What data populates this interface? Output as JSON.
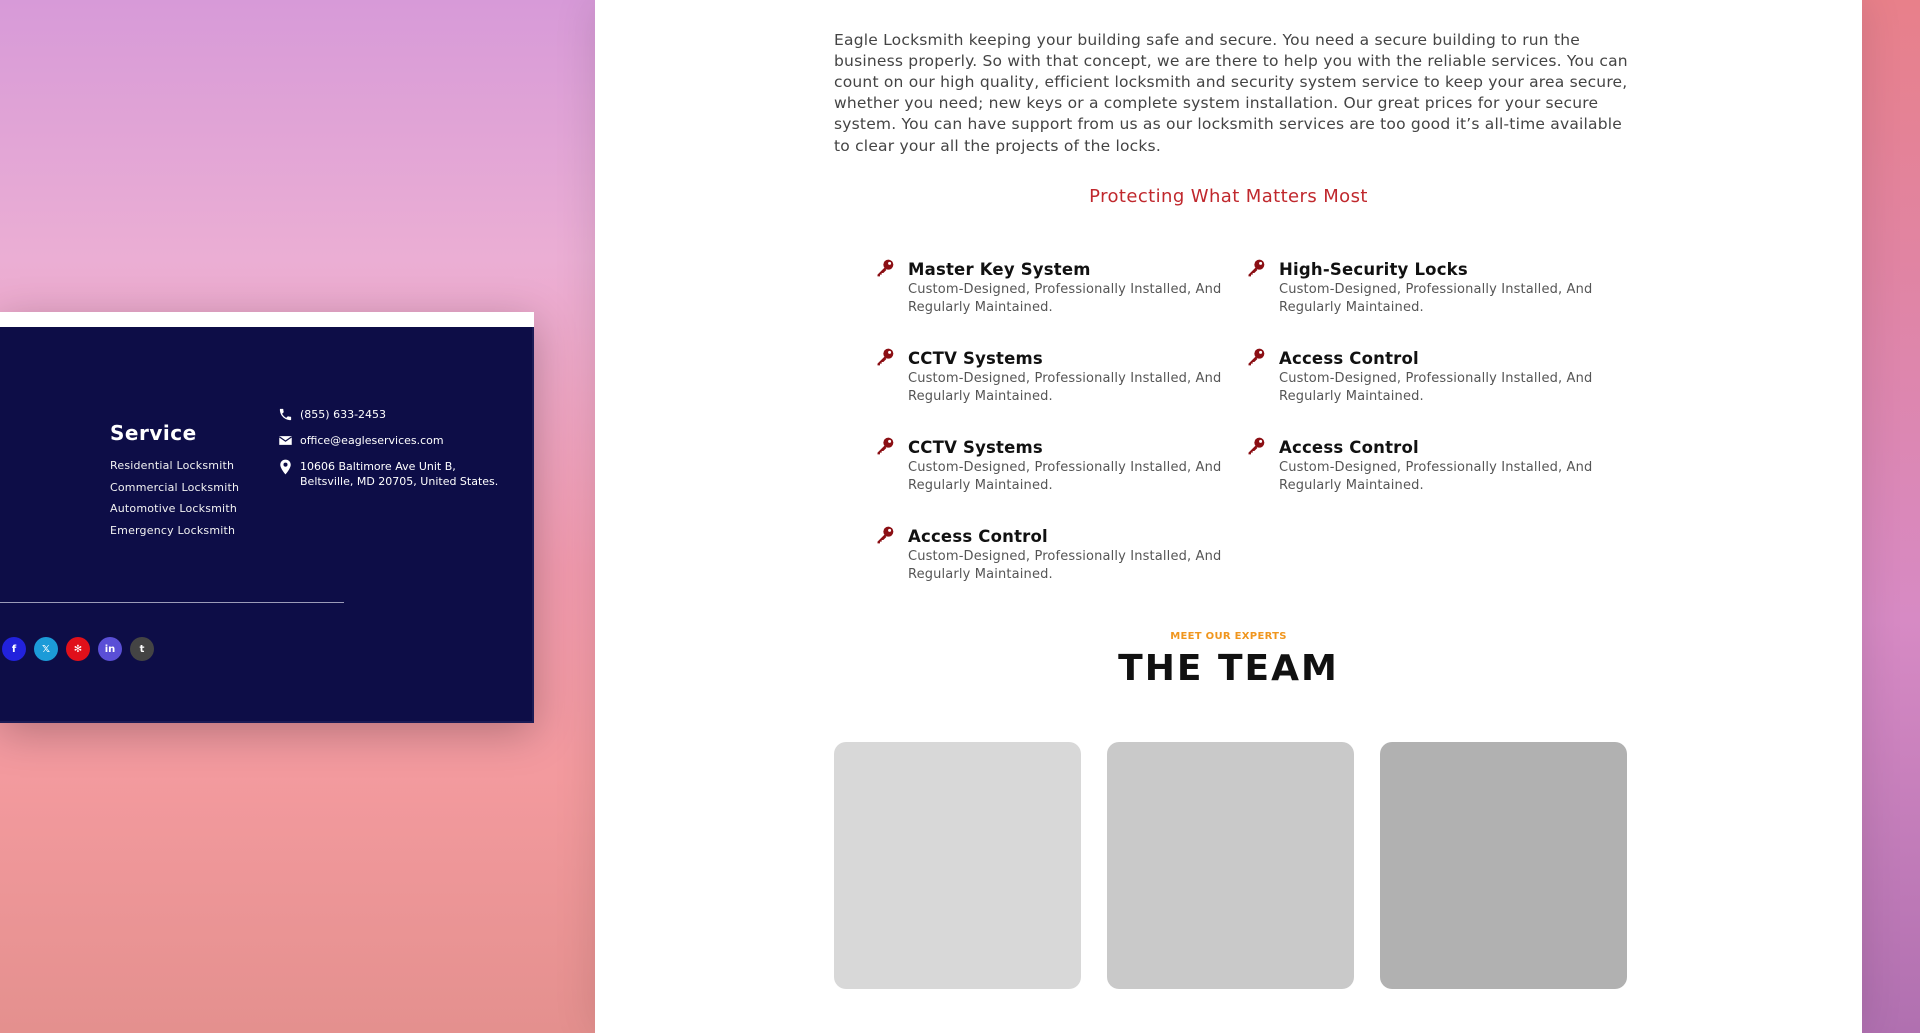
{
  "content": {
    "intro": "Eagle Locksmith keeping your building safe and secure. You need a secure building to run the business properly. So with that concept, we are there to help you with the reliable services. You can count on our high quality, efficient locksmith and security system service to keep your area secure, whether you need; new keys or a complete system installation. Our great prices for your secure system. You can have support from us as our locksmith services are too good it’s all-time available to clear your all the projects of the locks.",
    "section_title": "Protecting What Matters Most",
    "features": [
      {
        "title": "Master Key System",
        "desc": "Custom-Designed, Professionally Installed, And Regularly Maintained.",
        "icon": "key-icon"
      },
      {
        "title": "High-Security Locks",
        "desc": "Custom-Designed, Professionally Installed, And Regularly Maintained.",
        "icon": "key-icon"
      },
      {
        "title": "CCTV Systems",
        "desc": "Custom-Designed, Professionally Installed, And Regularly Maintained.",
        "icon": "key-icon"
      },
      {
        "title": "Access Control",
        "desc": "Custom-Designed, Professionally Installed, And Regularly Maintained.",
        "icon": "key-icon"
      },
      {
        "title": "CCTV Systems",
        "desc": "Custom-Designed, Professionally Installed, And Regularly Maintained.",
        "icon": "key-icon"
      },
      {
        "title": "Access Control",
        "desc": "Custom-Designed, Professionally Installed, And Regularly Maintained.",
        "icon": "key-icon"
      },
      {
        "title": "Access Control",
        "desc": "Custom-Designed, Professionally Installed, And Regularly Maintained.",
        "icon": "key-icon"
      }
    ],
    "team_kicker": "MEET OUR EXPERTS",
    "team_title": "THE TEAM"
  },
  "footer": {
    "service_title": "Service",
    "services": [
      "Residential Locksmith",
      "Commercial Locksmith",
      "Automotive Locksmith",
      "Emergency Locksmith"
    ],
    "phone": "(855) 633-2453",
    "email": "office@eagleservices.com",
    "address_line1": "10606 Baltimore Ave Unit B,",
    "address_line2": "Beltsville, MD 20705, United States.",
    "socials": [
      {
        "icon": "facebook-icon",
        "glyph": "f",
        "color": "#2222dd"
      },
      {
        "icon": "x-twitter-icon",
        "glyph": "𝕏",
        "color": "#1c9bd8"
      },
      {
        "icon": "yelp-icon",
        "glyph": "✻",
        "color": "#e0101a"
      },
      {
        "icon": "linkedin-icon",
        "glyph": "in",
        "color": "#5a4fd6"
      },
      {
        "icon": "tumblr-icon",
        "glyph": "t",
        "color": "#444444"
      }
    ]
  },
  "colors": {
    "accent_red": "#c0282d",
    "key_icon": "#8b0f14",
    "kicker_orange": "#f0961e",
    "footer_bg": "#0d0d47"
  }
}
